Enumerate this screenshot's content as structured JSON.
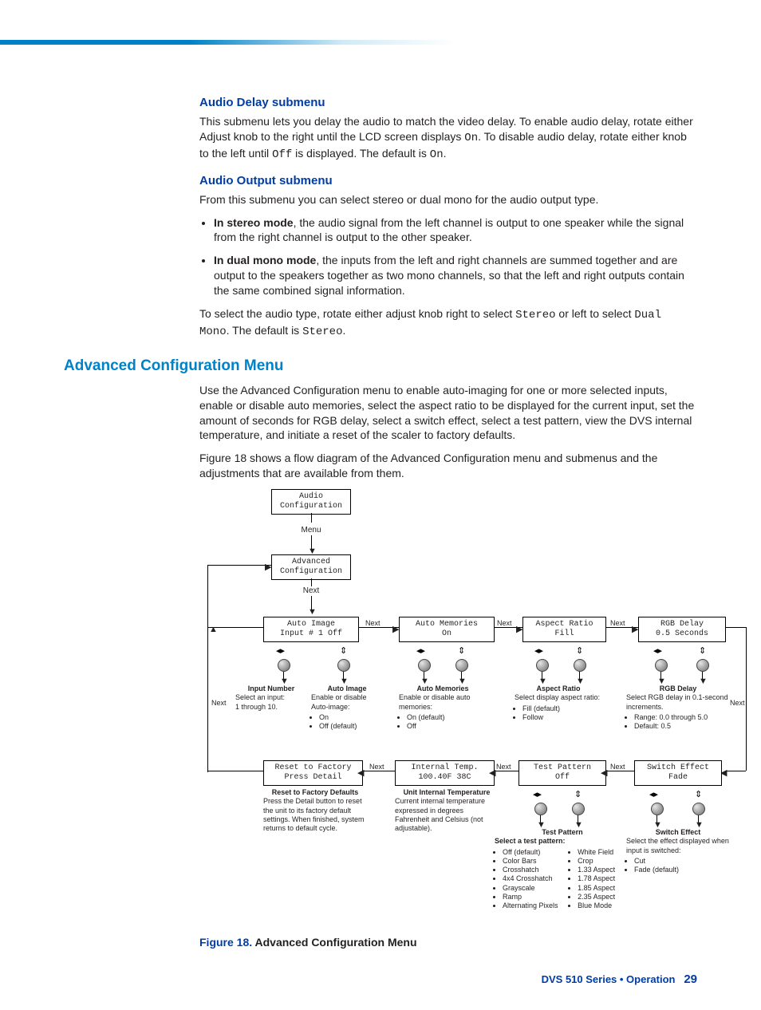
{
  "s1": {
    "h": "Audio Delay submenu",
    "p1a": "This submenu lets you delay the audio to match the video delay. To enable audio delay, rotate either Adjust knob to the right until the LCD screen displays ",
    "p1m1": "On",
    "p1b": ". To disable audio delay, rotate either knob to the left until ",
    "p1m2": "Off",
    "p1c": " is displayed. The default is ",
    "p1m3": "On",
    "p1d": "."
  },
  "s2": {
    "h": "Audio Output submenu",
    "p1": "From this submenu you can select stereo or dual mono for the audio output type.",
    "b1s": "In stereo mode",
    "b1": ", the audio signal from the left channel is output to one speaker while the signal from the right channel is output to the other speaker.",
    "b2s": "In dual mono mode",
    "b2": ", the inputs from the left and right channels are summed together and are output to the speakers together as two mono channels, so that the left and right outputs contain the same combined signal information.",
    "p2a": "To select the audio type, rotate either adjust knob right to select ",
    "p2m1": "Stereo",
    "p2b": " or left to select ",
    "p2m2": "Dual Mono",
    "p2c": ". The default is ",
    "p2m3": "Stereo",
    "p2d": "."
  },
  "s3": {
    "h": "Advanced Configuration Menu",
    "p1": "Use the Advanced Configuration menu to enable auto-imaging for one or more selected inputs, enable or disable auto memories, select the aspect ratio to be displayed for the current input, set the amount of seconds for RGB delay, select a switch effect, select a test pattern, view the DVS internal temperature, and initiate a reset of the scaler to factory defaults.",
    "p2": "Figure 18 shows a flow diagram of the Advanced Configuration menu and submenus and the adjustments that are available from them."
  },
  "diagram": {
    "b_audio": "Audio\nConfiguration",
    "b_adv": "Advanced\nConfiguration",
    "b_auto_img": "Auto Image\nInput # 1 Off",
    "b_auto_mem": "Auto Memories\nOn",
    "b_aspect": "Aspect Ratio\nFill",
    "b_rgb": "RGB Delay\n0.5 Seconds",
    "b_reset": "Reset to Factory\nPress Detail",
    "b_temp": "Internal Temp.\n100.40F   38C",
    "b_testp": "Test Pattern\nOff",
    "b_switch": "Switch Effect\nFade",
    "lbl_menu": "Menu",
    "lbl_next": "Next",
    "d_input_t": "Input Number",
    "d_input": "Select an input:\n1 through 10.",
    "d_autoimg_t": "Auto Image",
    "d_autoimg": "Enable or disable Auto-image:",
    "d_autoimg_l": [
      "On",
      "Off (default)"
    ],
    "d_automem_t": "Auto Memories",
    "d_automem": "Enable or disable auto memories:",
    "d_automem_l": [
      "On (default)",
      "Off"
    ],
    "d_aspect_t": "Aspect Ratio",
    "d_aspect": "Select display aspect ratio:",
    "d_aspect_l": [
      "Fill (default)",
      "Follow"
    ],
    "d_rgb_t": "RGB Delay",
    "d_rgb": "Select RGB delay in 0.1-second increments.",
    "d_rgb_l": [
      "Range: 0.0 through 5.0",
      "Default: 0.5"
    ],
    "d_reset_t": "Reset to Factory Defaults",
    "d_reset": "Press the Detail button to reset the unit to its factory default settings. When finished, system returns to default cycle.",
    "d_temp_t": "Unit Internal Temperature",
    "d_temp": "Current internal temperature expressed in degrees Fahrenheit and Celsius (not adjustable).",
    "d_test_t": "Test Pattern",
    "d_test_s": "Select a test pattern:",
    "d_test_l1": [
      "Off (default)",
      "Color Bars",
      "Crosshatch",
      "4x4 Crosshatch",
      "Grayscale",
      "Ramp",
      "Alternating Pixels"
    ],
    "d_test_l2": [
      "White Field",
      "Crop",
      "1.33 Aspect",
      "1.78 Aspect",
      "1.85 Aspect",
      "2.35 Aspect",
      "Blue Mode"
    ],
    "d_switch_t": "Switch Effect",
    "d_switch": "Select the effect displayed when input is switched:",
    "d_switch_l": [
      "Cut",
      "Fade (default)"
    ]
  },
  "figcap_n": "Figure 18.  ",
  "figcap_t": "Advanced Configuration Menu",
  "footer_t": "DVS 510 Series • Operation",
  "footer_p": "29"
}
